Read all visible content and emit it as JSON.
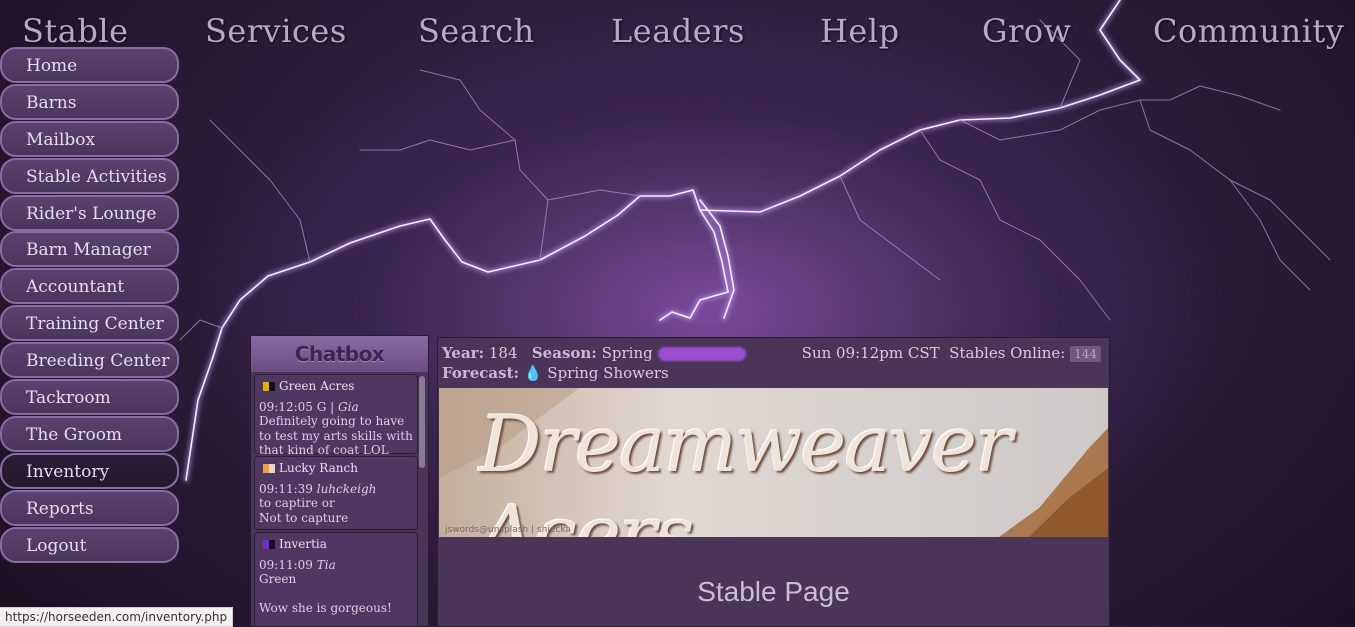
{
  "topnav": [
    "Stable",
    "Services",
    "Search",
    "Leaders",
    "Help",
    "Grow",
    "Community"
  ],
  "sidebar": {
    "items": [
      "Home",
      "Barns",
      "Mailbox",
      "Stable Activities",
      "Rider's Lounge",
      "Barn Manager",
      "Accountant",
      "Training Center",
      "Breeding Center",
      "Tackroom",
      "The Groom",
      "Inventory",
      "Reports",
      "Logout"
    ],
    "active": "Inventory"
  },
  "chatbox": {
    "title": "Chatbox",
    "messages": [
      {
        "ranch": "Green Acres",
        "flag_colors": [
          "#e0b000",
          "#111111"
        ],
        "time": "09:12:05",
        "user_prefix": "G |",
        "user": "Gia",
        "text": "Definitely going to have to test my arts skills with that kind of coat LOL"
      },
      {
        "ranch": "Lucky Ranch",
        "flag_colors": [
          "#f0a040",
          "#e8d8c0"
        ],
        "time": "09:11:39",
        "user_prefix": "",
        "user": "luhckeigh",
        "text": "to captire or\nNot to capture"
      },
      {
        "ranch": "Invertia",
        "flag_colors": [
          "#7a2ad0",
          "#1a0a2a"
        ],
        "time": "09:11:09",
        "user_prefix": "",
        "user": "Tia",
        "text": "Green\n\nWow she is gorgeous!"
      }
    ]
  },
  "infobar": {
    "year_label": "Year:",
    "year": "184",
    "season_label": "Season:",
    "season": "Spring",
    "forecast_label": "Forecast:",
    "forecast_icon": "rain-drop-icon",
    "forecast": "Spring Showers",
    "time": "Sun 09:12pm CST",
    "online_label": "Stables Online:",
    "online": "144"
  },
  "banner": {
    "title": "Dreamweaver Acers",
    "credit": "jswords@unsplash | shiecka"
  },
  "page_title": "Stable Page",
  "status_url": "https://horseeden.com/inventory.php"
}
